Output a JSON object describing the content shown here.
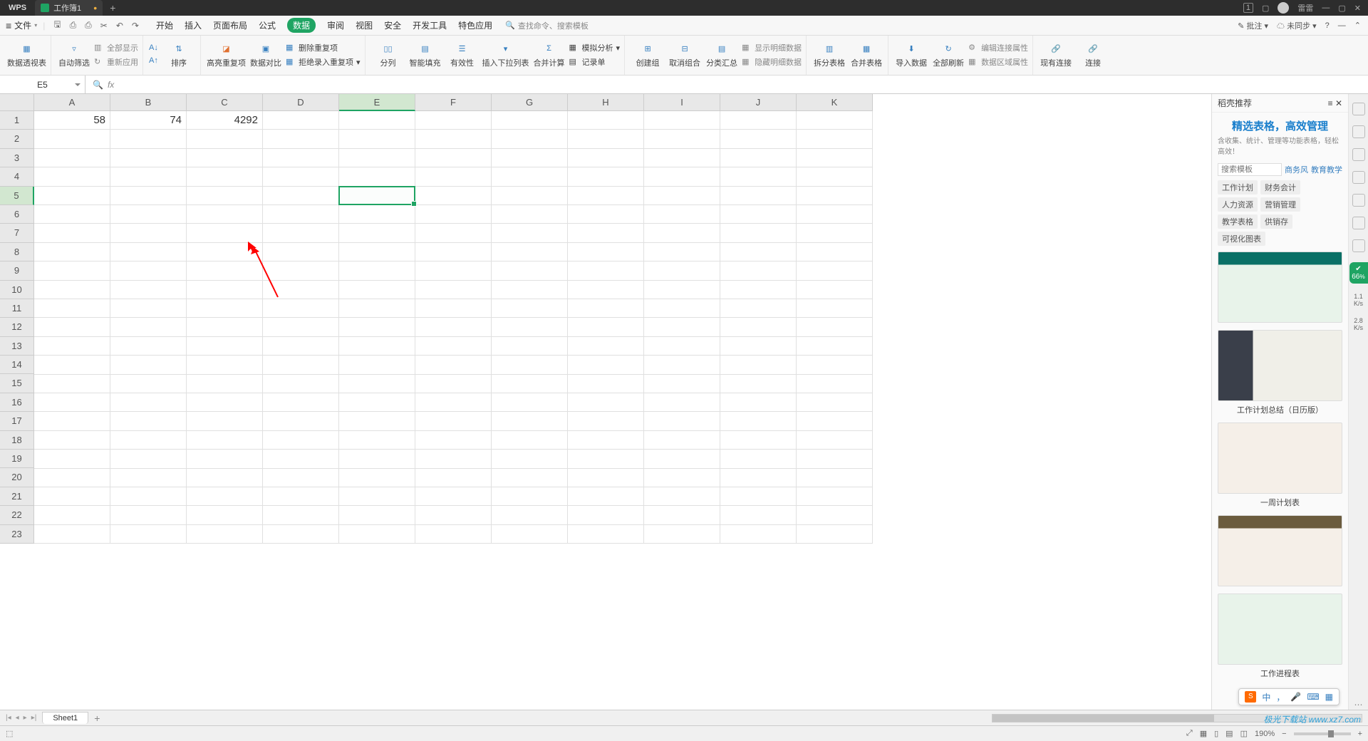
{
  "titlebar": {
    "app": "WPS",
    "tab": "工作簿1",
    "user": "雷雷"
  },
  "menubar": {
    "file": "文件",
    "tabs": [
      "开始",
      "插入",
      "页面布局",
      "公式",
      "数据",
      "审阅",
      "视图",
      "安全",
      "开发工具",
      "特色应用"
    ],
    "active_tab": "数据",
    "search_placeholder": "查找命令、搜索模板",
    "annotate": "批注",
    "unsync": "未同步"
  },
  "ribbon": {
    "pivot": "数据透视表",
    "autofilter": "自动筛选",
    "showall": "全部显示",
    "reapply": "重新应用",
    "sort_asc": "升序",
    "sort_desc": "降序",
    "sort": "排序",
    "highlight_dup": "高亮重复项",
    "data_compare": "数据对比",
    "remove_dup": "删除重复项",
    "reject_dup": "拒绝录入重复项",
    "text_to_col": "分列",
    "flash_fill": "智能填充",
    "validation": "有效性",
    "dropdown": "插入下拉列表",
    "consolidate": "合并计算",
    "record": "记录单",
    "sim_analysis": "模拟分析",
    "group": "创建组",
    "ungroup": "取消组合",
    "subtotal": "分类汇总",
    "show_detail": "显示明细数据",
    "hide_detail": "隐藏明细数据",
    "split_table": "拆分表格",
    "merge_table": "合并表格",
    "import": "导入数据",
    "refresh_all": "全部刷新",
    "edit_conn": "编辑连接属性",
    "data_region": "数据区域属性",
    "existing_conn": "现有连接",
    "connection": "连接"
  },
  "namebox": {
    "ref": "E5"
  },
  "columns": [
    "A",
    "B",
    "C",
    "D",
    "E",
    "F",
    "G",
    "H",
    "I",
    "J",
    "K"
  ],
  "rows": [
    "1",
    "2",
    "3",
    "4",
    "5",
    "6",
    "7",
    "8",
    "9",
    "10",
    "11",
    "12",
    "13",
    "14",
    "15",
    "16",
    "17",
    "18",
    "19",
    "20",
    "21",
    "22",
    "23"
  ],
  "cells": {
    "A1": "58",
    "B1": "74",
    "C1": "4292"
  },
  "selection": {
    "col": 4,
    "row": 4
  },
  "rpanel": {
    "header": "稻壳推荐",
    "title": "精选表格，高效管理",
    "subtitle": "含收集、统计、管理等功能表格，轻松高效！",
    "search_placeholder": "搜索模板",
    "links": [
      "商务风",
      "教育教学"
    ],
    "tags": [
      "工作计划",
      "财务会计",
      "人力资源",
      "营销管理",
      "教学表格",
      "供销存",
      "可视化图表"
    ],
    "templates": [
      {
        "caption": ""
      },
      {
        "caption": "工作计划总结（日历版）"
      },
      {
        "caption": "一周计划表"
      },
      {
        "caption": ""
      },
      {
        "caption": "工作进程表"
      }
    ]
  },
  "iconrail": {
    "badge": "66",
    "speed1": "1.1",
    "unit1": "K/s",
    "speed2": "2.8",
    "unit2": "K/s"
  },
  "sheettabs": {
    "name": "Sheet1"
  },
  "status": {
    "zoom": "190%"
  },
  "ime": {
    "lang": "中",
    "punct": "，"
  },
  "watermark": "极光下载站 www.xz7.com"
}
